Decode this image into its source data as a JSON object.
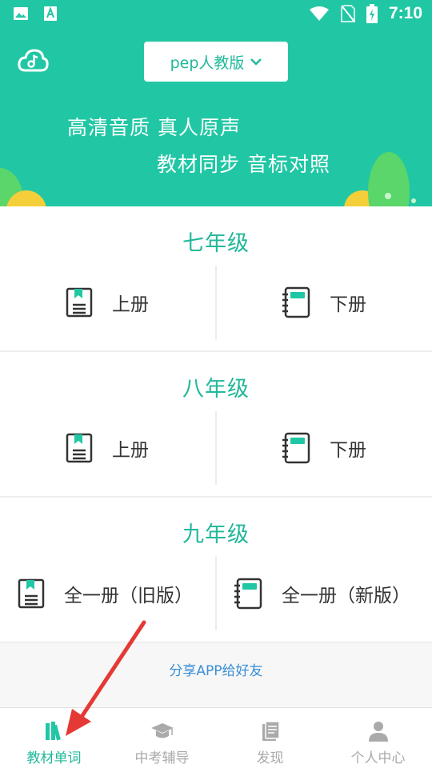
{
  "status_bar": {
    "time": "7:10"
  },
  "header": {
    "edition_label": "pep人教版",
    "slogan_line1": "高清音质 真人原声",
    "slogan_line2": "教材同步 音标对照"
  },
  "grades": [
    {
      "title": "七年级",
      "left_label": "上册",
      "right_label": "下册"
    },
    {
      "title": "八年级",
      "left_label": "上册",
      "right_label": "下册"
    },
    {
      "title": "九年级",
      "left_label": "全一册（旧版）",
      "right_label": "全一册（新版）"
    }
  ],
  "share": {
    "label": "分享APP给好友"
  },
  "bottom_nav": [
    {
      "label": "教材单词",
      "icon": "books-icon",
      "active": true
    },
    {
      "label": "中考辅导",
      "icon": "graduation-cap-icon",
      "active": false
    },
    {
      "label": "发现",
      "icon": "document-icon",
      "active": false
    },
    {
      "label": "个人中心",
      "icon": "person-icon",
      "active": false
    }
  ],
  "colors": {
    "accent": "#21c7a4",
    "accent_text": "#21b89a",
    "link": "#3a8fd6",
    "annotation": "#e53935"
  }
}
